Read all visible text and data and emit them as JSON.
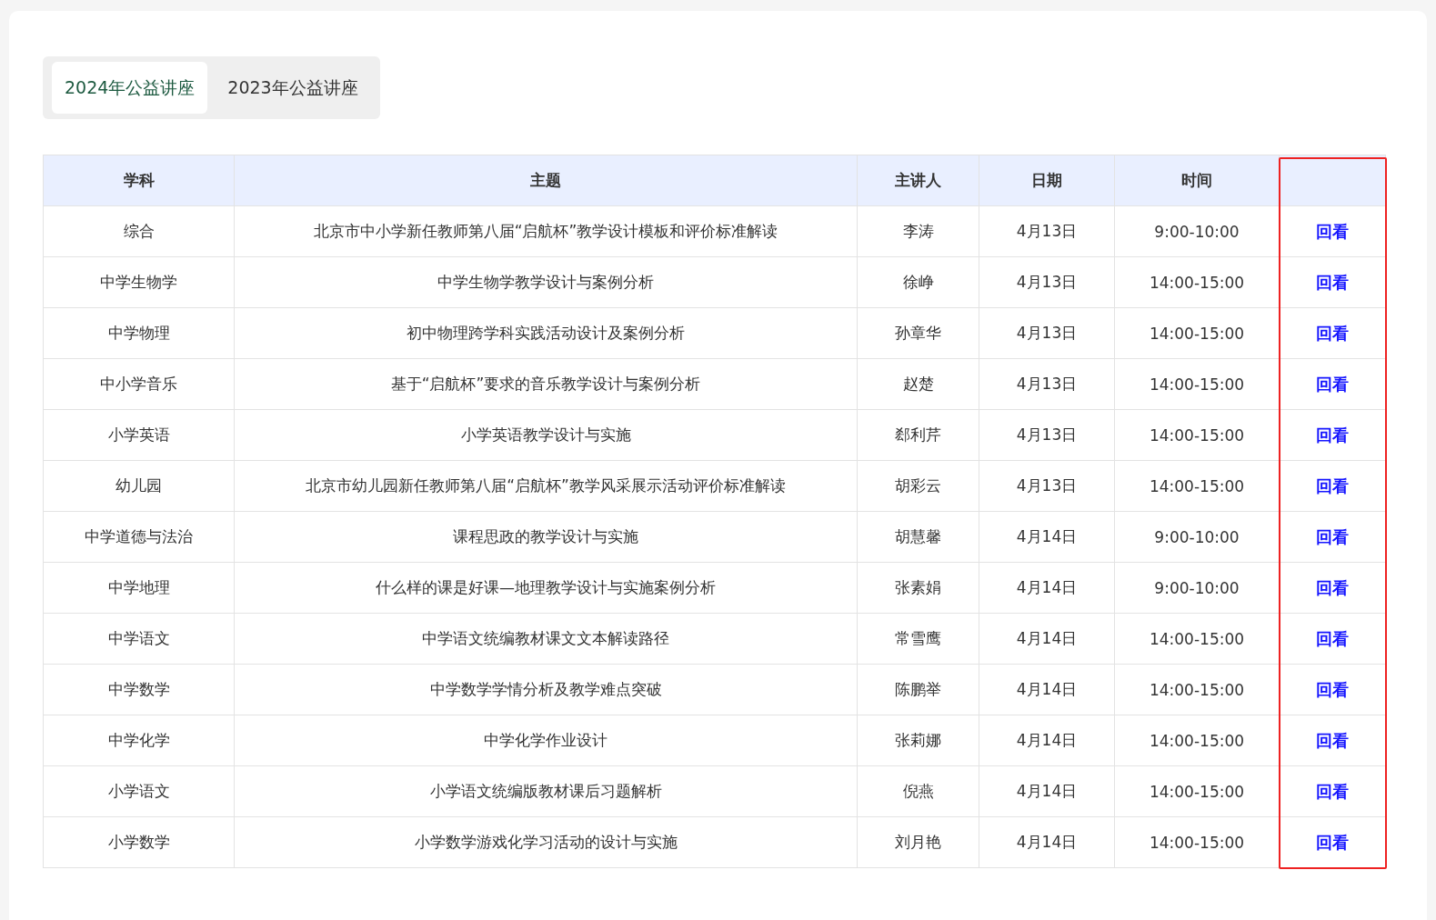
{
  "tabs": [
    {
      "label": "2024年公益讲座",
      "selected": true
    },
    {
      "label": "2023年公益讲座",
      "selected": false
    }
  ],
  "table": {
    "columns": [
      "学科",
      "主题",
      "主讲人",
      "日期",
      "时间"
    ],
    "rows": [
      {
        "subject": "综合",
        "topic": "北京市中小学新任教师第八届“启航杯”教学设计模板和评价标准解读",
        "speaker": "李涛",
        "date": "4月13日",
        "time": "9:00-10:00",
        "action": "回看"
      },
      {
        "subject": "中学生物学",
        "topic": "中学生物学教学设计与案例分析",
        "speaker": "徐峥",
        "date": "4月13日",
        "time": "14:00-15:00",
        "action": "回看"
      },
      {
        "subject": "中学物理",
        "topic": "初中物理跨学科实践活动设计及案例分析",
        "speaker": "孙章华",
        "date": "4月13日",
        "time": "14:00-15:00",
        "action": "回看"
      },
      {
        "subject": "中小学音乐",
        "topic": "基于“启航杯”要求的音乐教学设计与案例分析",
        "speaker": "赵楚",
        "date": "4月13日",
        "time": "14:00-15:00",
        "action": "回看"
      },
      {
        "subject": "小学英语",
        "topic": "小学英语教学设计与实施",
        "speaker": "郄利芹",
        "date": "4月13日",
        "time": "14:00-15:00",
        "action": "回看"
      },
      {
        "subject": "幼儿园",
        "topic": "北京市幼儿园新任教师第八届“启航杯”教学风采展示活动评价标准解读",
        "speaker": "胡彩云",
        "date": "4月13日",
        "time": "14:00-15:00",
        "action": "回看"
      },
      {
        "subject": "中学道德与法治",
        "topic": "课程思政的教学设计与实施",
        "speaker": "胡慧馨",
        "date": "4月14日",
        "time": "9:00-10:00",
        "action": "回看"
      },
      {
        "subject": "中学地理",
        "topic": "什么样的课是好课—地理教学设计与实施案例分析",
        "speaker": "张素娟",
        "date": "4月14日",
        "time": "9:00-10:00",
        "action": "回看"
      },
      {
        "subject": "中学语文",
        "topic": "中学语文统编教材课文文本解读路径",
        "speaker": "常雪鹰",
        "date": "4月14日",
        "time": "14:00-15:00",
        "action": "回看"
      },
      {
        "subject": "中学数学",
        "topic": "中学数学学情分析及教学难点突破",
        "speaker": "陈鹏举",
        "date": "4月14日",
        "time": "14:00-15:00",
        "action": "回看"
      },
      {
        "subject": "中学化学",
        "topic": "中学化学作业设计",
        "speaker": "张莉娜",
        "date": "4月14日",
        "time": "14:00-15:00",
        "action": "回看"
      },
      {
        "subject": "小学语文",
        "topic": "小学语文统编版教材课后习题解析",
        "speaker": "倪燕",
        "date": "4月14日",
        "time": "14:00-15:00",
        "action": "回看"
      },
      {
        "subject": "小学数学",
        "topic": "小学数学游戏化学习活动的设计与实施",
        "speaker": "刘月艳",
        "date": "4月14日",
        "time": "14:00-15:00",
        "action": "回看"
      }
    ]
  }
}
